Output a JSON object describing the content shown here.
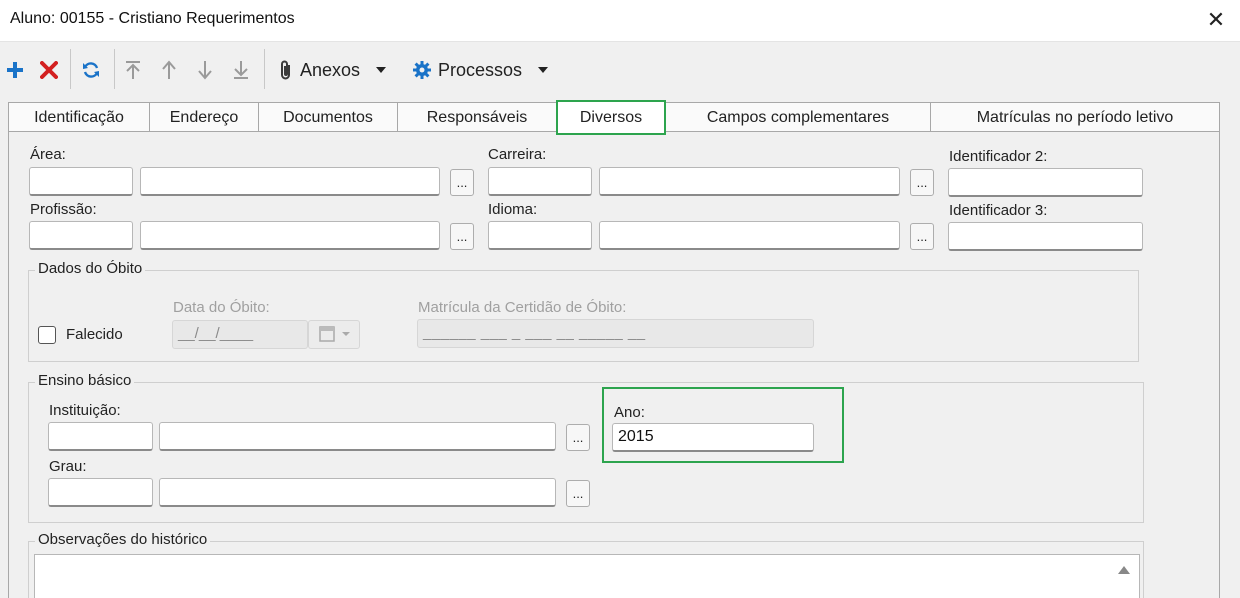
{
  "window": {
    "title": "Aluno: 00155 - Cristiano Requerimentos",
    "close_glyph": "✕"
  },
  "toolbar": {
    "add_icon": "plus-icon",
    "delete_icon": "x-icon",
    "refresh_icon": "refresh-icon",
    "first_icon": "arrow-first-icon",
    "up_icon": "arrow-up-icon",
    "down_icon": "arrow-down-icon",
    "last_icon": "arrow-last-icon",
    "anexos_label": "Anexos",
    "processos_label": "Processos",
    "colors": {
      "add": "#1a73c8",
      "delete": "#d32020",
      "refresh": "#1a73c8",
      "nav": "#9a9a9a"
    }
  },
  "tabs": [
    {
      "label": "Identificação",
      "active": false
    },
    {
      "label": "Endereço",
      "active": false
    },
    {
      "label": "Documentos",
      "active": false
    },
    {
      "label": "Responsáveis",
      "active": false
    },
    {
      "label": "Diversos",
      "active": true
    },
    {
      "label": "Campos complementares",
      "active": false
    },
    {
      "label": "Matrículas no período letivo",
      "active": false
    }
  ],
  "fields": {
    "area_label": "Área:",
    "carreira_label": "Carreira:",
    "identificador2_label": "Identificador 2:",
    "profissao_label": "Profissão:",
    "idioma_label": "Idioma:",
    "identificador3_label": "Identificador 3:",
    "lookup_button": "...",
    "area_code": "",
    "area_desc": "",
    "carreira_code": "",
    "carreira_desc": "",
    "identificador2": "",
    "profissao_code": "",
    "profissao_desc": "",
    "idioma_code": "",
    "idioma_desc": "",
    "identificador3": ""
  },
  "obito": {
    "legend": "Dados do Óbito",
    "falecido_label": "Falecido",
    "falecido_checked": false,
    "data_label": "Data do Óbito:",
    "data_value": "__/__/____",
    "matricula_label": "Matrícula da Certidão de Óbito:",
    "matricula_value": "______ ___ _ ___ __ _____ __"
  },
  "ensino": {
    "legend": "Ensino básico",
    "instituicao_label": "Instituição:",
    "grau_label": "Grau:",
    "ano_label": "Ano:",
    "ano_value": "2015",
    "instituicao_code": "",
    "instituicao_desc": "",
    "grau_code": "",
    "grau_desc": ""
  },
  "observacoes": {
    "legend": "Observações do histórico",
    "text": ""
  },
  "accent": "#2da44e"
}
